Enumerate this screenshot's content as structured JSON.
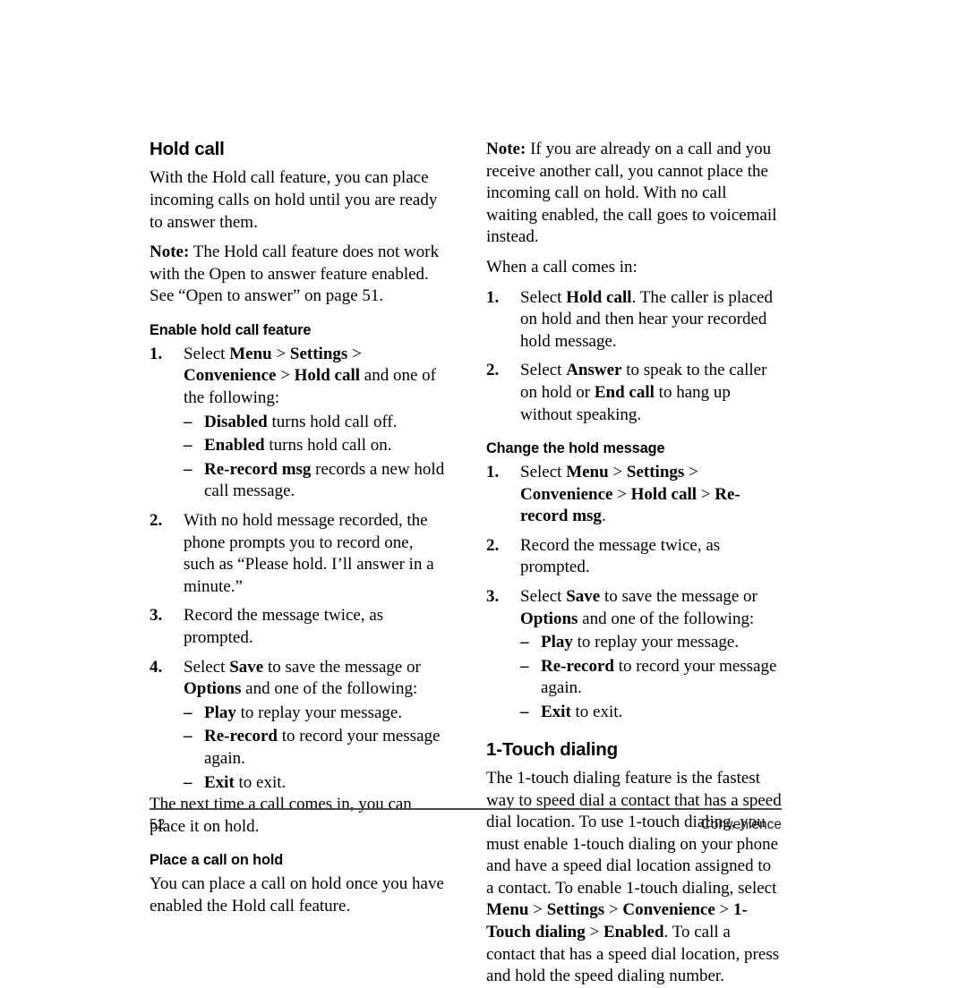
{
  "page": {
    "number": "52",
    "chapter": "Convenience"
  },
  "left_column": {
    "heading": "Hold call",
    "intro": "With the Hold call feature, you can place incoming calls on hold until you are ready to answer them.",
    "note_label": "Note:",
    "note_text": "The Hold call feature does not work with the Open to answer feature enabled. See “Open to answer” on page 51.",
    "subheading_enable": "Enable hold call feature",
    "steps": [
      {
        "num": "1.",
        "prefix": "Select ",
        "path": [
          {
            "text": "Menu",
            "bold": true
          },
          {
            "text": " > ",
            "bold": false
          },
          {
            "text": "Settings",
            "bold": true
          },
          {
            "text": " > ",
            "bold": false
          },
          {
            "text": "Convenience",
            "bold": true
          },
          {
            "text": " > ",
            "bold": false
          },
          {
            "text": "Hold call",
            "bold": true
          }
        ],
        "suffix": " and one of the following:",
        "sub": [
          {
            "dash": "–",
            "term": "Disabled",
            "rest": " turns hold call off."
          },
          {
            "dash": "–",
            "term": "Enabled",
            "rest": " turns hold call on."
          },
          {
            "dash": "–",
            "term": "Re-record msg",
            "rest": " records a new hold call message."
          }
        ]
      },
      {
        "num": "2.",
        "text": "With no hold message recorded, the phone prompts you to record one, such as “Please hold. I’ll answer in a minute.”"
      },
      {
        "num": "3.",
        "text": "Record the message twice, as prompted."
      },
      {
        "num": "4.",
        "prefix": "Select ",
        "term1": "Save",
        "mid": " to save the message or ",
        "term2": "Options",
        "suffix": " and one of the following:",
        "sub": [
          {
            "dash": "–",
            "term": "Play",
            "rest": " to replay your message."
          },
          {
            "dash": "–",
            "term": "Re-record",
            "rest": " to record your message again."
          },
          {
            "dash": "–",
            "term": "Exit",
            "rest": " to exit."
          }
        ]
      }
    ],
    "closing": "The next time a call comes in, you can place it on hold.",
    "subheading_place": "Place a call on hold",
    "place_text": "You can place a call on hold once you have enabled the Hold call feature."
  },
  "right_column": {
    "note_label": "Note:",
    "note_text": "If you are already on a call and you receive another call, you cannot place the incoming call on hold. With no call waiting enabled, the call goes to voicemail instead.",
    "lead_in": "When a call comes in:",
    "incoming_steps": [
      {
        "num": "1.",
        "prefix": "Select ",
        "term1": "Hold call",
        "suffix": ". The caller is placed on hold and then hear your recorded hold message."
      },
      {
        "num": "2.",
        "prefix": "Select ",
        "term1": "Answer",
        "mid": " to speak to the caller on hold or ",
        "term2": "End call",
        "suffix": " to hang up without speaking."
      }
    ],
    "subheading_change": "Change the hold message",
    "change_steps": [
      {
        "num": "1.",
        "prefix": "Select ",
        "path": [
          {
            "text": "Menu",
            "bold": true
          },
          {
            "text": " > ",
            "bold": false
          },
          {
            "text": "Settings",
            "bold": true
          },
          {
            "text": " > ",
            "bold": false
          },
          {
            "text": "Convenience",
            "bold": true
          },
          {
            "text": " > ",
            "bold": false
          },
          {
            "text": "Hold call",
            "bold": true
          },
          {
            "text": " > ",
            "bold": false
          },
          {
            "text": "Re-record msg",
            "bold": true
          }
        ],
        "suffix": "."
      },
      {
        "num": "2.",
        "text": "Record the message twice, as prompted."
      },
      {
        "num": "3.",
        "prefix": "Select ",
        "term1": "Save",
        "mid": " to save the message or ",
        "term2": "Options",
        "suffix": " and one of the following:",
        "sub": [
          {
            "dash": "–",
            "term": "Play",
            "rest": " to replay your message."
          },
          {
            "dash": "–",
            "term": "Re-record",
            "rest": " to record your message again."
          },
          {
            "dash": "–",
            "term": "Exit",
            "rest": " to exit."
          }
        ]
      }
    ],
    "heading_touch": "1-Touch dialing",
    "touch_p1": "The 1-touch dialing feature is the fastest way to speed dial a contact that has a speed dial location. To use 1-touch dialing, you must enable 1-touch dialing on your phone and have a speed dial location assigned to a contact. To enable 1-touch dialing, select ",
    "touch_path": [
      {
        "text": "Menu",
        "bold": true
      },
      {
        "text": " > ",
        "bold": false
      },
      {
        "text": "Settings",
        "bold": true
      },
      {
        "text": " > ",
        "bold": false
      },
      {
        "text": "Convenience",
        "bold": true
      },
      {
        "text": " > ",
        "bold": false
      },
      {
        "text": "1-Touch dialing",
        "bold": true
      },
      {
        "text": " > ",
        "bold": false
      },
      {
        "text": "Enabled",
        "bold": true
      }
    ],
    "touch_p2": ". To call a contact that has a speed dial location, press and hold the speed dialing number."
  }
}
